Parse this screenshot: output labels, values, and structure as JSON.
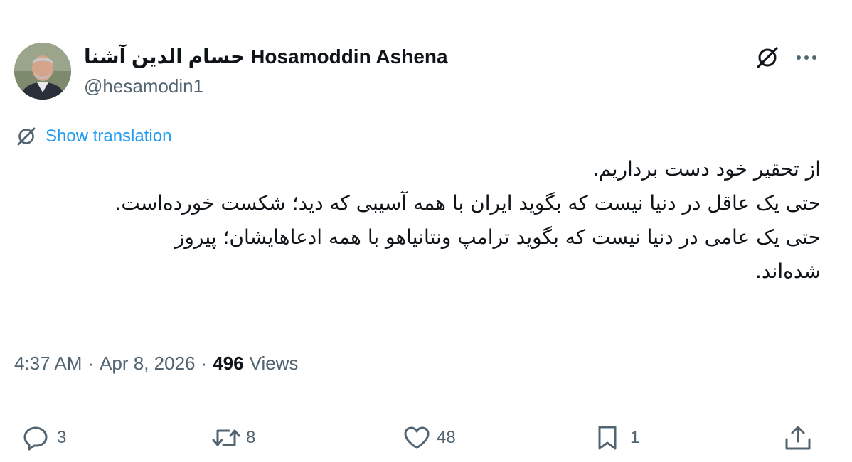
{
  "author": {
    "display_name": "حسام الدين آشنا Hosamoddin Ashena",
    "handle": "@hesamodin1",
    "avatar_icon": "profile-photo"
  },
  "header_icons": {
    "grok": "grok-icon",
    "more": "more-horizontal-icon"
  },
  "translate": {
    "label": "Show translation",
    "icon": "grok-translate-icon",
    "color": "#1d9bf0"
  },
  "tweet": {
    "lines": [
      "از تحقیر خود دست برداریم.",
      "حتی یک عاقل در دنیا نیست که بگوید ایران با همه آسیبی که دید؛ شکست خورده‌است.",
      "حتی یک عامی در دنیا نیست که بگوید ترامپ ونتانیاهو با همه ادعاهایشان؛ پیروز شده‌اند."
    ]
  },
  "meta": {
    "time": "4:37 AM",
    "separator": "·",
    "date": "Apr 8, 2026",
    "views_count": "496",
    "views_label": "Views"
  },
  "actions": {
    "replies": "3",
    "reposts": "8",
    "likes": "48",
    "bookmarks": "1"
  },
  "colors": {
    "text": "#0f1419",
    "secondary": "#536471",
    "accent": "#1d9bf0",
    "divider": "#eff3f4"
  }
}
